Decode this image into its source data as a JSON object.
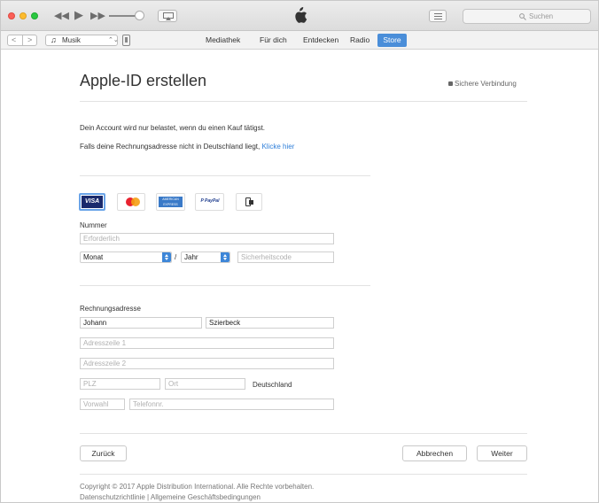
{
  "window": {
    "search_placeholder": "Suchen"
  },
  "toolbar": {
    "media_type": "Musik",
    "nav_prev_icon": "chevron-left",
    "nav_next_icon": "chevron-right"
  },
  "nav": {
    "items": [
      "Mediathek",
      "Für dich",
      "Entdecken",
      "Radio"
    ],
    "active": "Store"
  },
  "page": {
    "title": "Apple-ID erstellen",
    "secure_label": "Sichere Verbindung",
    "account_note": "Dein Account wird nur belastet, wenn du einen Kauf tätigst.",
    "address_note": "Falls deine Rechnungsadresse nicht in Deutschland liegt,",
    "address_link": "Klicke hier"
  },
  "payment": {
    "methods": [
      "VISA",
      "Mastercard",
      "American Express",
      "PayPal",
      "Mobile"
    ],
    "selected": "VISA",
    "visa_label": "VISA",
    "amex_label": "AMERICAN EXPRESS",
    "paypal_label": "P PayPal",
    "number_label": "Nummer",
    "number_placeholder": "Erforderlich",
    "month_value": "Monat",
    "separator": "/",
    "year_value": "Jahr",
    "cvc_placeholder": "Sicherheitscode"
  },
  "billing": {
    "label": "Rechnungsadresse",
    "first_name": "Johann",
    "last_name": "Szierbeck",
    "address1_placeholder": "Adresszeile 1",
    "address2_placeholder": "Adresszeile 2",
    "zip_placeholder": "PLZ",
    "city_placeholder": "Ort",
    "country": "Deutschland",
    "area_code_placeholder": "Vorwahl",
    "phone_placeholder": "Telefonnr."
  },
  "buttons": {
    "back": "Zurück",
    "cancel": "Abbrechen",
    "next": "Weiter"
  },
  "footer": {
    "copyright": "Copyright © 2017 Apple Distribution International. Alle Rechte vorbehalten.",
    "privacy": "Datenschutzrichtlinie",
    "divider": "|",
    "terms": "Allgemeine Geschäftsbedingungen"
  }
}
